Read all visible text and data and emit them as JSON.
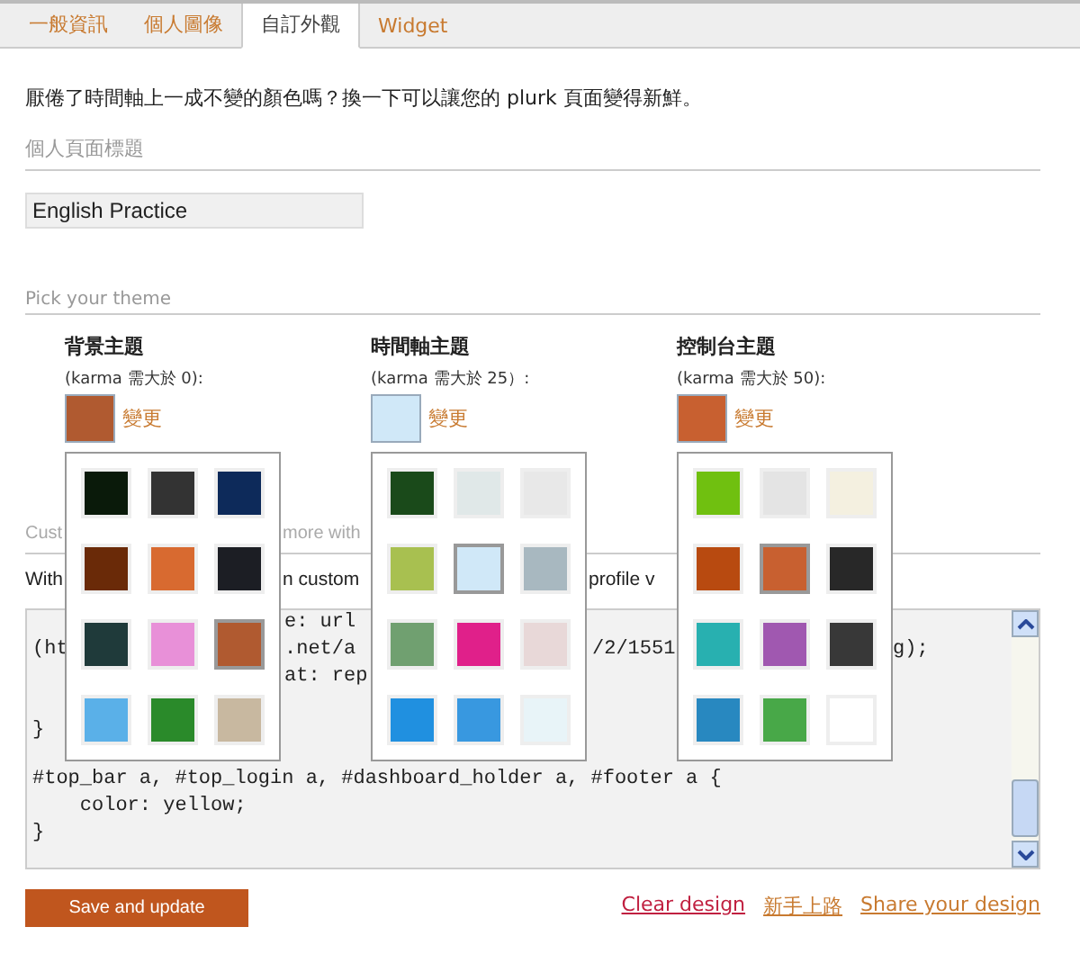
{
  "tabs": [
    {
      "label": "一般資訊",
      "selected": false
    },
    {
      "label": "個人圖像",
      "selected": false
    },
    {
      "label": "自訂外觀",
      "selected": true
    },
    {
      "label": "Widget",
      "selected": false
    }
  ],
  "intro": "厭倦了時間軸上一成不變的顏色嗎？換一下可以讓您的 plurk 頁面變得新鮮。",
  "title_section": {
    "heading": "個人頁面標題",
    "value": "English Practice"
  },
  "theme_section": {
    "heading": "Pick your theme",
    "themes": [
      {
        "title": "背景主題",
        "karma": "(karma 需大於 0):",
        "change_link": "變更",
        "swatches": [
          {
            "color": "#0a1a0a",
            "selected": false
          },
          {
            "color": "#333333",
            "selected": false
          },
          {
            "color": "#0d2a5a",
            "selected": false
          },
          {
            "color": "#6a2a08",
            "selected": false
          },
          {
            "color": "#d86a30",
            "selected": false
          },
          {
            "color": "#1c1e24",
            "selected": false
          },
          {
            "color": "#1f3a3a",
            "selected": false
          },
          {
            "color": "#e890d8",
            "selected": false
          },
          {
            "color": "#b05a30",
            "selected": true
          },
          {
            "color": "#5ab0e8",
            "selected": false
          },
          {
            "color": "#2a8a2a",
            "selected": false
          },
          {
            "color": "#c8b8a0",
            "selected": false
          }
        ]
      },
      {
        "title": "時間軸主題",
        "karma": "(karma 需大於 25）:",
        "change_link": "變更",
        "swatches": [
          {
            "color": "#1a4a1a",
            "selected": false
          },
          {
            "color": "#e0e8e8",
            "selected": false
          },
          {
            "color": "#e8e8e8",
            "selected": false
          },
          {
            "color": "#a8c050",
            "selected": false
          },
          {
            "color": "#d0e8f8",
            "selected": true
          },
          {
            "color": "#a8b8c0",
            "selected": false
          },
          {
            "color": "#70a070",
            "selected": false
          },
          {
            "color": "#e0208a",
            "selected": false
          },
          {
            "color": "#e8d8d8",
            "selected": false
          },
          {
            "color": "#2090e0",
            "selected": false
          },
          {
            "color": "#3898e0",
            "selected": false
          },
          {
            "color": "#e8f4f8",
            "selected": false
          }
        ]
      },
      {
        "title": "控制台主題",
        "karma": "(karma 需大於 50):",
        "change_link": "變更",
        "swatches": [
          {
            "color": "#70c010",
            "selected": false
          },
          {
            "color": "#e4e4e4",
            "selected": false
          },
          {
            "color": "#f4f0e0",
            "selected": false
          },
          {
            "color": "#b84a10",
            "selected": false
          },
          {
            "color": "#c86030",
            "selected": true
          },
          {
            "color": "#282828",
            "selected": false
          },
          {
            "color": "#28b0b0",
            "selected": false
          },
          {
            "color": "#a058b0",
            "selected": false
          },
          {
            "color": "#383838",
            "selected": false
          },
          {
            "color": "#2888c0",
            "selected": false
          },
          {
            "color": "#48a848",
            "selected": false
          },
          {
            "color": "#ffffff",
            "selected": false
          }
        ]
      }
    ]
  },
  "css_section": {
    "heading": [
      "Cust",
      "more with"
    ],
    "description": [
      "With",
      "n custom",
      "profile v"
    ],
    "code_lines": [
      {
        "kind": "indented",
        "segments": [
          "e: url"
        ]
      },
      {
        "kind": "flush",
        "segments": [
          "(ht",
          ".net/a",
          "/2/1551",
          "g);"
        ]
      },
      {
        "kind": "indented",
        "segments": [
          "at: rep"
        ]
      },
      {
        "kind": "flush",
        "segments": [
          "}"
        ]
      },
      {
        "kind": "flush",
        "segments": [
          "#top_bar a, #top_login a, #dashboard_holder a, #footer a {"
        ]
      },
      {
        "kind": "flush",
        "segments": [
          "    color: yellow;"
        ]
      },
      {
        "kind": "flush",
        "segments": [
          "}"
        ]
      }
    ]
  },
  "save_button": "Save and update",
  "links": [
    "Clear design",
    "新手上路",
    "Share your design"
  ]
}
